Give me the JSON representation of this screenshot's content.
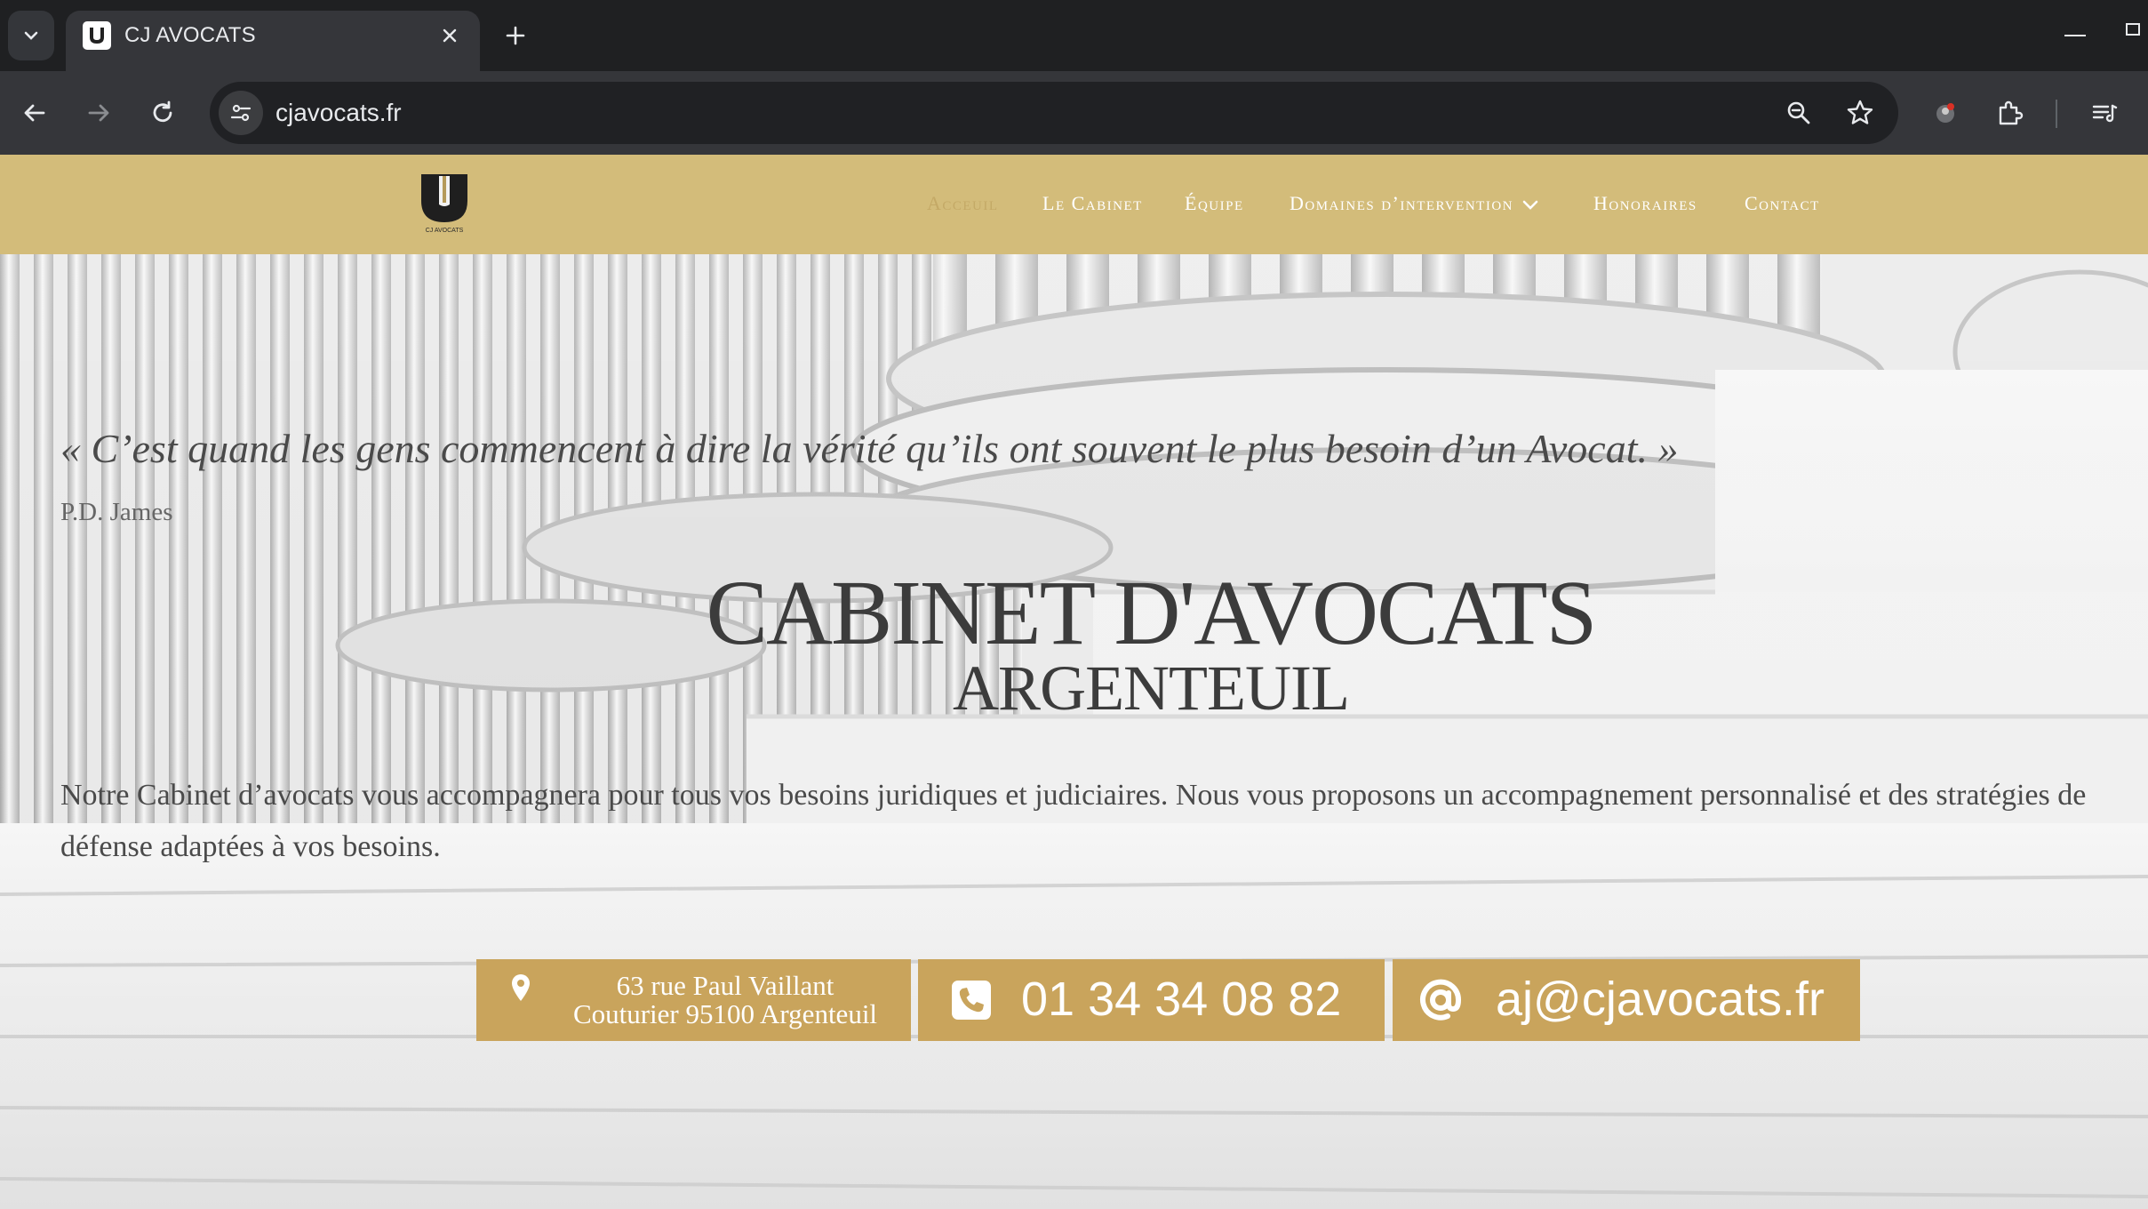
{
  "browser": {
    "tab_title": "CJ AVOCATS",
    "url": "cjavocats.fr"
  },
  "site": {
    "logo_text": "CJ AVOCATS",
    "nav": [
      {
        "label": "Acceuil",
        "active": true
      },
      {
        "label": "Le Cabinet",
        "active": false
      },
      {
        "label": "Équipe",
        "active": false
      },
      {
        "label": "Domaines d’intervention",
        "active": false,
        "has_dropdown": true
      },
      {
        "label": "Honoraires",
        "active": false
      },
      {
        "label": "Contact",
        "active": false
      }
    ]
  },
  "hero": {
    "quote": "« C’est quand les gens commencent à dire la vérité qu’ils ont souvent le plus besoin d’un Avocat. »",
    "quote_author": "P.D. James",
    "title": "CABINET D'AVOCATS",
    "subtitle": "ARGENTEUIL",
    "intro_line1": "Notre Cabinet d’avocats vous accompagnera pour tous vos besoins juridiques et judiciaires. Nous vous proposons un accompagnement personnalisé et des stratégies de",
    "intro_line2": "défense adaptées à vos besoins."
  },
  "contact": {
    "address_line1": "63 rue Paul Vaillant",
    "address_line2": "Couturier 95100 Argenteuil",
    "phone": "01 34 34 08 82",
    "email": "aj@cjavocats.fr"
  },
  "colors": {
    "header_gold": "#d3bc7a",
    "button_gold": "#c9a45c",
    "active_nav": "#c4a966",
    "chrome_dark": "#1f2022",
    "chrome_toolbar": "#35363a"
  },
  "icons": [
    "tab-search-icon",
    "favicon-icon",
    "close-icon",
    "plus-icon",
    "minimize-icon",
    "back-icon",
    "forward-icon",
    "reload-icon",
    "site-info-icon",
    "zoom-icon",
    "star-icon",
    "profile-icon",
    "extensions-icon",
    "reading-list-icon",
    "map-pin-icon",
    "phone-icon",
    "at-icon",
    "chevron-down-icon"
  ]
}
